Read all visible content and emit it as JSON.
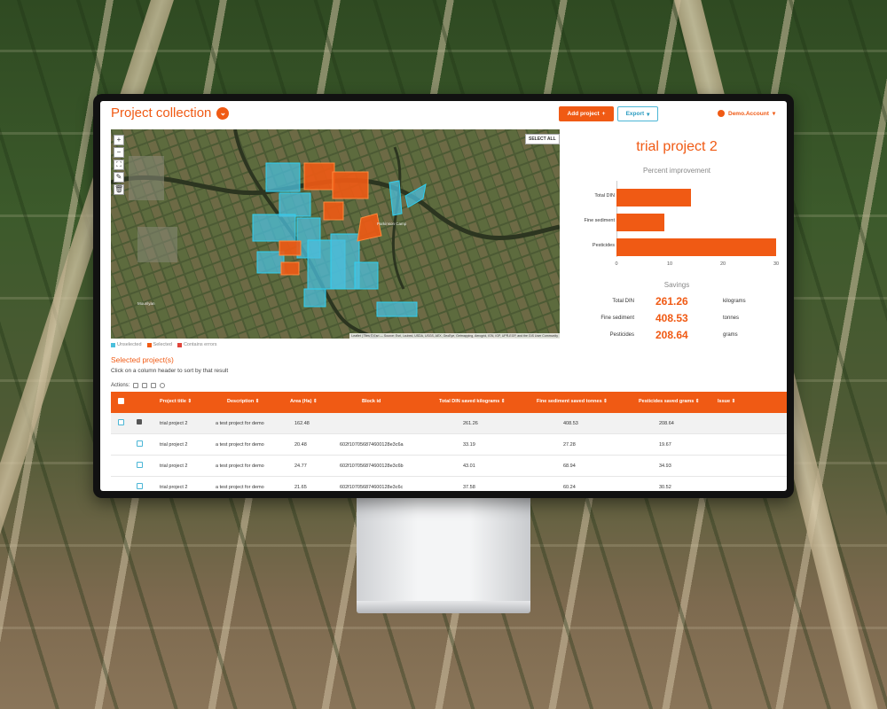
{
  "header": {
    "title": "Project collection",
    "add_label": "Add project",
    "export_label": "Export",
    "account_label": "Demo.Account"
  },
  "map": {
    "select_all_label": "SELECT ALL",
    "attribution": "Leaflet | Tiles © Esri — Source: Esri, i-cubed, USDA, USGS, AEX, GeoEye, Getmapping, Aerogrid, IGN, IGP, UPR-EGP, and the GIS User Community",
    "controls": [
      "+",
      "−",
      "⛶",
      "✎",
      "🗑"
    ],
    "legend": [
      {
        "label": "Unselected",
        "color": "#4bbfdc"
      },
      {
        "label": "Selected",
        "color": "#f05a14"
      },
      {
        "label": "Contains errors",
        "color": "#e0443b"
      }
    ]
  },
  "project_summary": {
    "title": "trial project 2",
    "improvement_title": "Percent improvement",
    "savings_title": "Savings",
    "savings": [
      {
        "label": "Total DIN",
        "value": "261.26",
        "unit": "kilograms"
      },
      {
        "label": "Fine sediment",
        "value": "408.53",
        "unit": "tonnes"
      },
      {
        "label": "Pesticides",
        "value": "208.64",
        "unit": "grams"
      }
    ]
  },
  "chart_data": {
    "type": "bar",
    "orientation": "horizontal",
    "title": "Percent improvement",
    "categories": [
      "Total DIN",
      "Fine sediment",
      "Pesticides"
    ],
    "values": [
      14,
      9,
      30
    ],
    "xlim": [
      0,
      30
    ],
    "xticks": [
      "0",
      "10",
      "20",
      "30"
    ],
    "color": "#f05a14"
  },
  "selected": {
    "title": "Selected project(s)",
    "help": "Click on a column header to sort by that result",
    "actions_label": "Actions:"
  },
  "table": {
    "headers": [
      "Project title ⇕",
      "Description ⇕",
      "Area (Ha) ⇕",
      "Block id",
      "Total DIN saved kilograms ⇕",
      "Fine sediment saved tonnes ⇕",
      "Pesticides saved grams ⇕",
      "Issue ⇕"
    ],
    "rows": [
      {
        "title": "trial project 2",
        "description": "a test project for demo",
        "area": "162.48",
        "block": "",
        "din": "261.26",
        "sediment": "408.53",
        "pesticides": "208.64",
        "issue": ""
      },
      {
        "title": "trial project 2",
        "description": "a test project for demo",
        "area": "20.48",
        "block": "602f107056874600128e3c6a",
        "din": "33.19",
        "sediment": "27.28",
        "pesticides": "19.67",
        "issue": ""
      },
      {
        "title": "trial project 2",
        "description": "a test project for demo",
        "area": "24.77",
        "block": "602f107056874600128e3c6b",
        "din": "43.01",
        "sediment": "68.94",
        "pesticides": "34.93",
        "issue": ""
      },
      {
        "title": "trial project 2",
        "description": "a test project for demo",
        "area": "21.65",
        "block": "602f107056874600128e3c6c",
        "din": "37.58",
        "sediment": "60.24",
        "pesticides": "30.52",
        "issue": ""
      }
    ]
  }
}
